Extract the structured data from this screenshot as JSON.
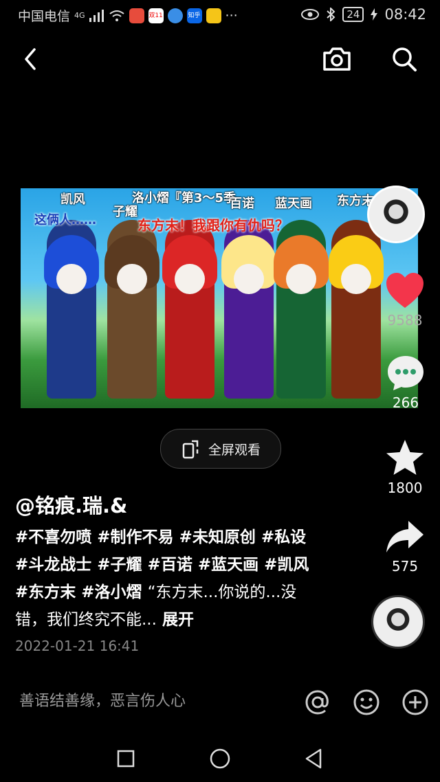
{
  "status_bar": {
    "carrier": "中国电信",
    "network": "4G",
    "battery": "24",
    "time": "08:42",
    "app_icon_labels": [
      "",
      "双11",
      "",
      "知乎"
    ],
    "more": "···"
  },
  "top_bar": {
    "back_icon": "chevron-left-icon",
    "camera_icon": "camera-icon",
    "search_icon": "search-icon"
  },
  "video": {
    "captions": [
      "凯风",
      "子耀",
      "洛小熠『第3～5季",
      "百诺",
      "蓝天画",
      "东方末",
      "这俩人……",
      "东方末！我跟你有仇吗？"
    ]
  },
  "right_rail": {
    "like_count": "9588",
    "comment_count": "266",
    "favorite_count": "1800",
    "share_count": "575"
  },
  "fullscreen_button": {
    "label": "全屏观看"
  },
  "post": {
    "author": "@铭痕.瑞.&",
    "hashtags": "#不喜勿喷 #制作不易 #未知原创 #私设 #斗龙战士 #子耀 #百诺 #蓝天画 #凯风 #东方末 #洛小熠",
    "quote": "“东方末...你说的...没错，我们终究不能...",
    "expand": "展开",
    "date": "2022-01-21 16:41"
  },
  "comment_bar": {
    "placeholder": "善语结善缘，恶言伤人心",
    "mention_icon": "at-icon",
    "emoji_icon": "emoji-icon",
    "add_icon": "plus-circle-icon"
  },
  "nav_bar": {
    "recents_icon": "square-icon",
    "home_icon": "circle-icon",
    "back_icon": "triangle-back-icon"
  },
  "colors": {
    "like_red": "#f3354b",
    "background": "#000000"
  }
}
